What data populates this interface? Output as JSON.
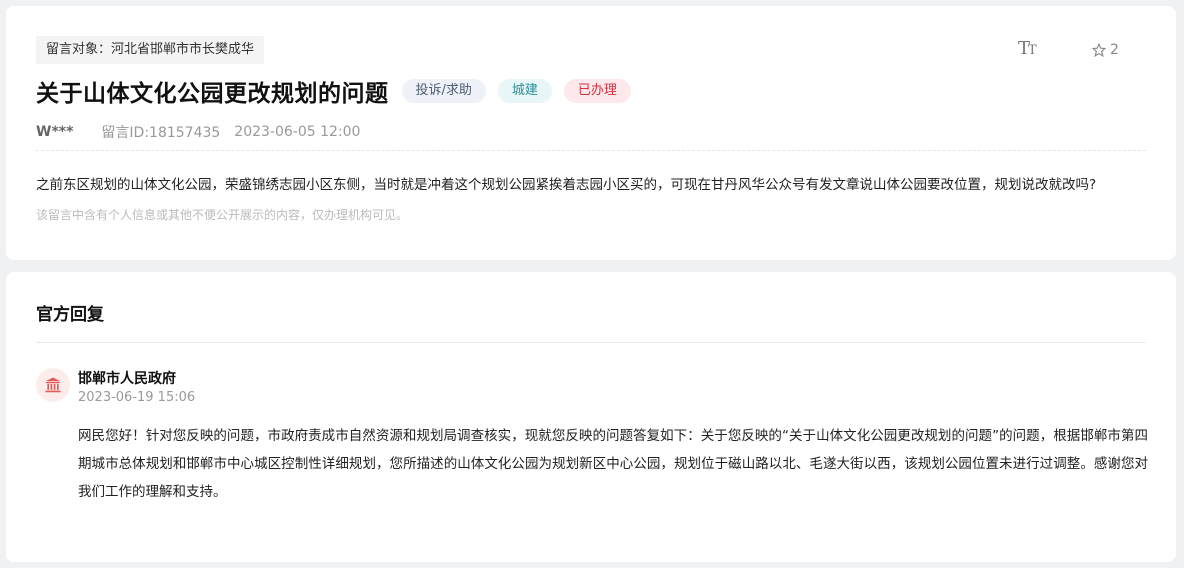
{
  "message": {
    "target_label": "留言对象：河北省邯郸市市长樊成华",
    "font_size_icon": "Tt",
    "favorite_count": "2",
    "title": "关于山体文化公园更改规划的问题",
    "tags": {
      "type": "投诉/求助",
      "category": "城建",
      "status": "已办理"
    },
    "author": "W***",
    "message_id": "留言ID:18157435",
    "datetime": "2023-06-05 12:00",
    "content": "之前东区规划的山体文化公园，荣盛锦绣志园小区东侧，当时就是冲着这个规划公园紧挨着志园小区买的，可现在甘丹风华公众号有发文章说山体公园要改位置，规划说改就改吗?",
    "privacy_note": "该留言中含有个人信息或其他不便公开展示的内容，仅办理机构可见。"
  },
  "reply": {
    "heading": "官方回复",
    "org_name": "邯郸市人民政府",
    "datetime": "2023-06-19 15:06",
    "body": "网民您好！针对您反映的问题，市政府责成市自然资源和规划局调查核实，现就您反映的问题答复如下：关于您反映的“关于山体文化公园更改规划的问题”的问题，根据邯郸市第四期城市总体规划和邯郸市中心城区控制性详细规划，您所描述的山体文化公园为规划新区中心公园，规划位于磁山路以北、毛遂大街以西，该规划公园位置未进行过调整。感谢您对我们工作的理解和支持。"
  },
  "colors": {
    "status_red": "#d6303e",
    "category_teal": "#2d8f99",
    "avatar_red": "#e05a5a"
  }
}
